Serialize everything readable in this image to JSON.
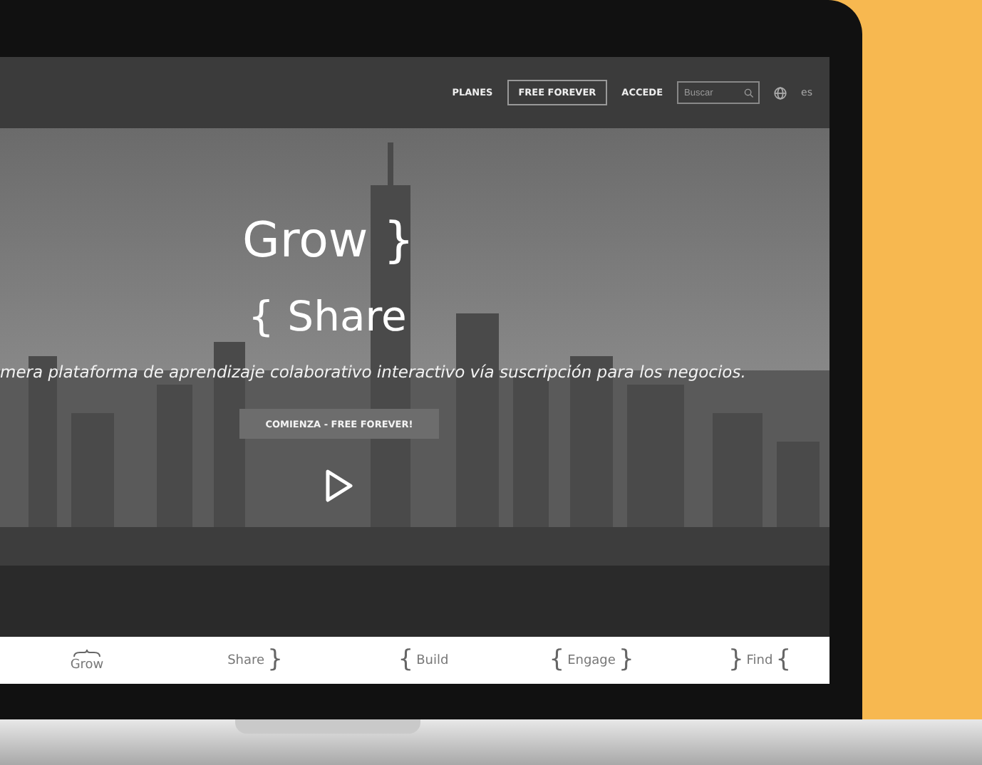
{
  "nav": {
    "links": [
      {
        "label": "PLANES",
        "kind": "link"
      },
      {
        "label": "FREE FOREVER",
        "kind": "outlined"
      },
      {
        "label": "ACCEDE",
        "kind": "link"
      }
    ],
    "search": {
      "placeholder": "Buscar"
    },
    "language": "es"
  },
  "hero": {
    "title": "Grow }",
    "subtitle": "{ Share",
    "tagline": "mera plataforma de aprendizaje colaborativo interactivo vía suscripción para los negocios.",
    "cta": "COMIENZA - FREE FOREVER!"
  },
  "tabs": [
    {
      "label": "Grow",
      "brace_above": true
    },
    {
      "label": "Share",
      "after": "}",
      "brace_above": false
    },
    {
      "label": "Build",
      "before": "{",
      "brace_above": false
    },
    {
      "label": "Engage",
      "before": "{",
      "after": "}",
      "brace_above": false
    },
    {
      "label": "Find",
      "before": "}",
      "after": "{",
      "brace_above": false
    }
  ]
}
